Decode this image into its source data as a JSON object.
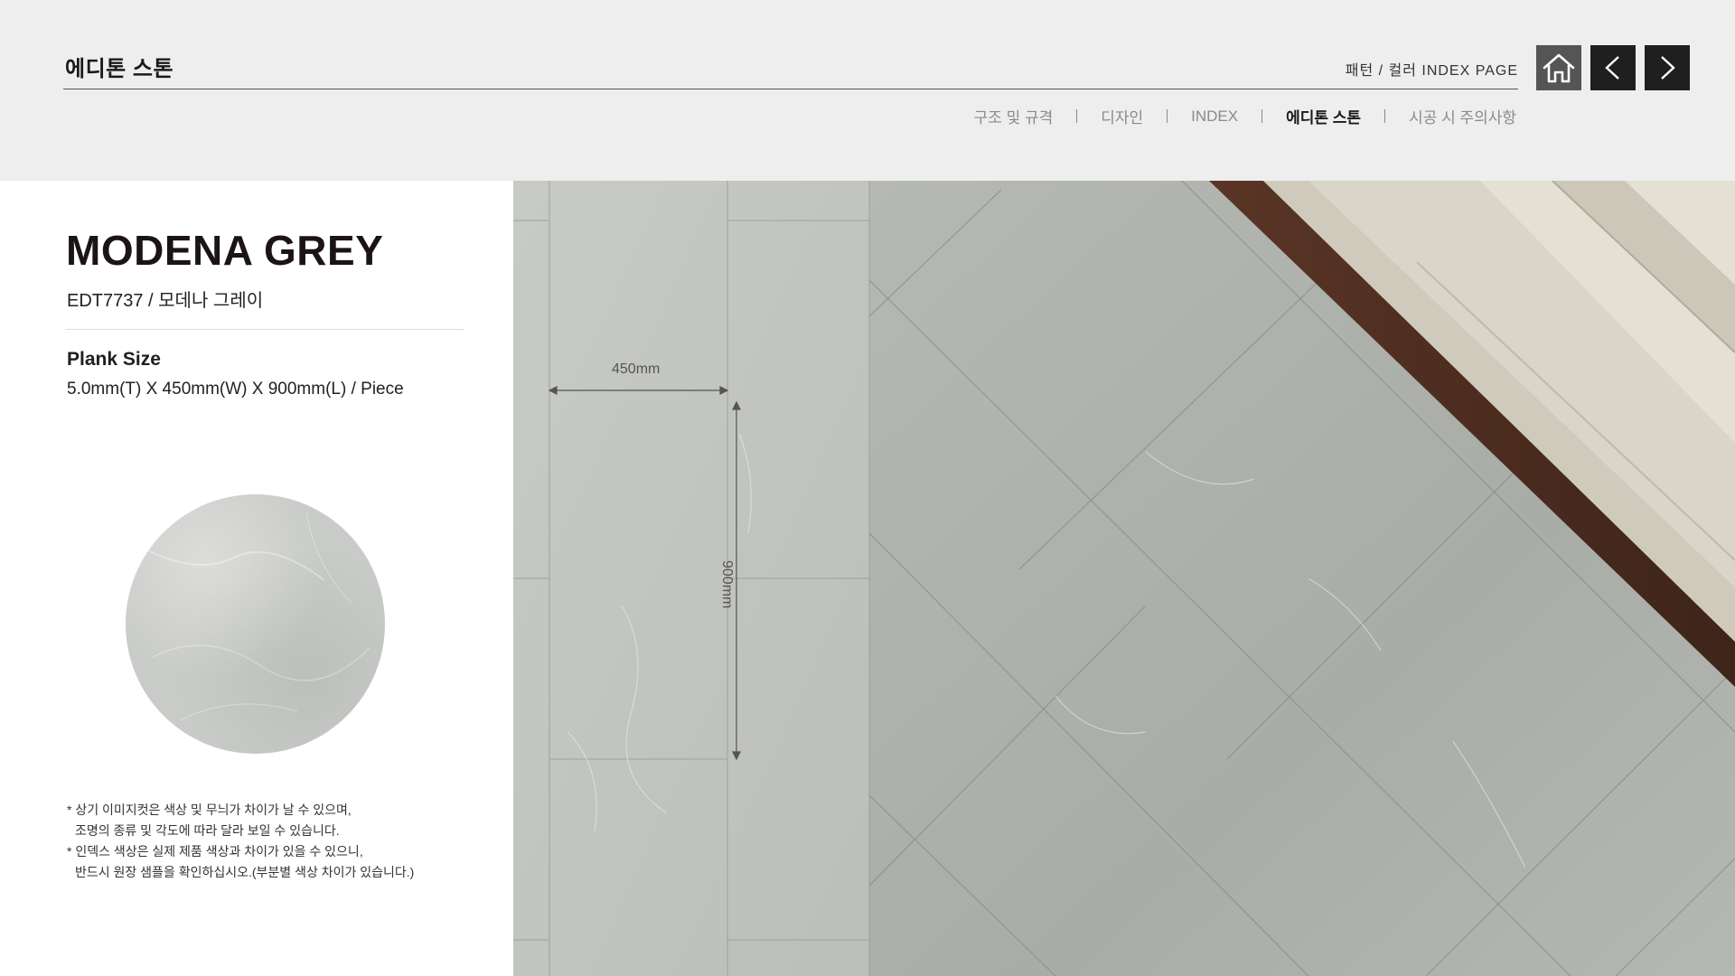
{
  "header": {
    "title": "에디톤 스톤",
    "index_link": "패턴 / 컬러 INDEX PAGE",
    "buttons": {
      "home_icon": "home-icon",
      "prev_icon": "chevron-left-icon",
      "next_icon": "chevron-right-icon"
    }
  },
  "menu": {
    "items": [
      {
        "label": "구조 및 규격",
        "active": false
      },
      {
        "label": "디자인",
        "active": false
      },
      {
        "label": "INDEX",
        "active": false
      },
      {
        "label": "에디톤 스톤",
        "active": true
      },
      {
        "label": "시공 시 주의사항",
        "active": false
      }
    ]
  },
  "product": {
    "name": "MODENA GREY",
    "code": "EDT7737 / 모데나 그레이",
    "size_label": "Plank Size",
    "size_value": "5.0mm(T) X 450mm(W) X 900mm(L) / Piece"
  },
  "notes": [
    "* 상기 이미지컷은 색상 및 무늬가 차이가 날 수 있으며,",
    "조명의 종류 및 각도에 따라 달라 보일 수 있습니다.",
    "* 인덱스 색상은 실제 제품 색상과 차이가 있을 수 있으니,",
    "반드시 원장 샘플을 확인하십시오.(부분별 색상 차이가 있습니다.)"
  ],
  "dimensions": {
    "width_label": "450mm",
    "length_label": "900mm"
  },
  "colors": {
    "header_bg": "#eeeeee",
    "dark_button": "#1f1f1f",
    "home_button": "#555555",
    "stone": "#c4c6c2"
  }
}
